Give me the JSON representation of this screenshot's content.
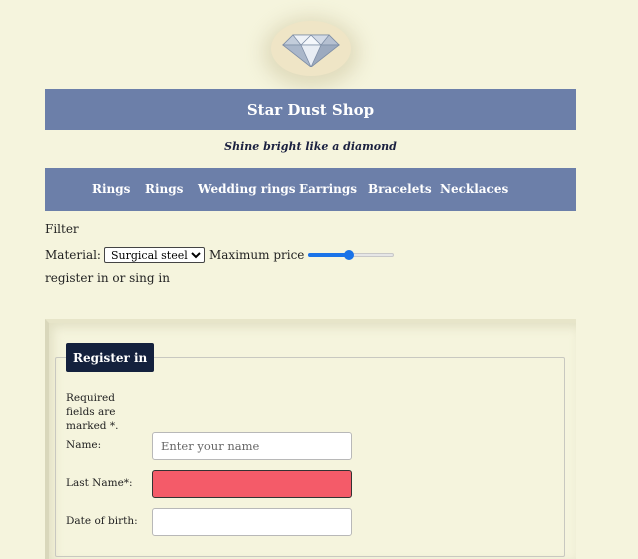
{
  "shop": {
    "title": "Star Dust Shop",
    "tagline": "Shine bright like a diamond"
  },
  "nav": {
    "items": [
      {
        "label": "Rings"
      },
      {
        "label": "Rings"
      },
      {
        "label": "Wedding rings"
      },
      {
        "label": "Earrings"
      },
      {
        "label": "Bracelets"
      },
      {
        "label": "Necklaces"
      }
    ]
  },
  "filter": {
    "heading": "Filter",
    "material_label": "Material:",
    "material_selected": "Surgical steel",
    "max_price_label": "Maximum price",
    "max_price_fraction": 0.48
  },
  "register_link": "register in or sing in",
  "form": {
    "legend": "Register in",
    "required_note": "Required fields are marked *.",
    "name_label": "Name:",
    "name_placeholder": "Enter your name",
    "lastname_label": "Last Name*:",
    "lastname_value": "",
    "dob_label": "Date of birth:",
    "dob_value": ""
  },
  "colors": {
    "background": "#f5f4dd",
    "bars": "#6c7fa9",
    "legend_bg": "#14213d",
    "error_field": "#f45b69",
    "slider_accent": "#1a73e8"
  }
}
